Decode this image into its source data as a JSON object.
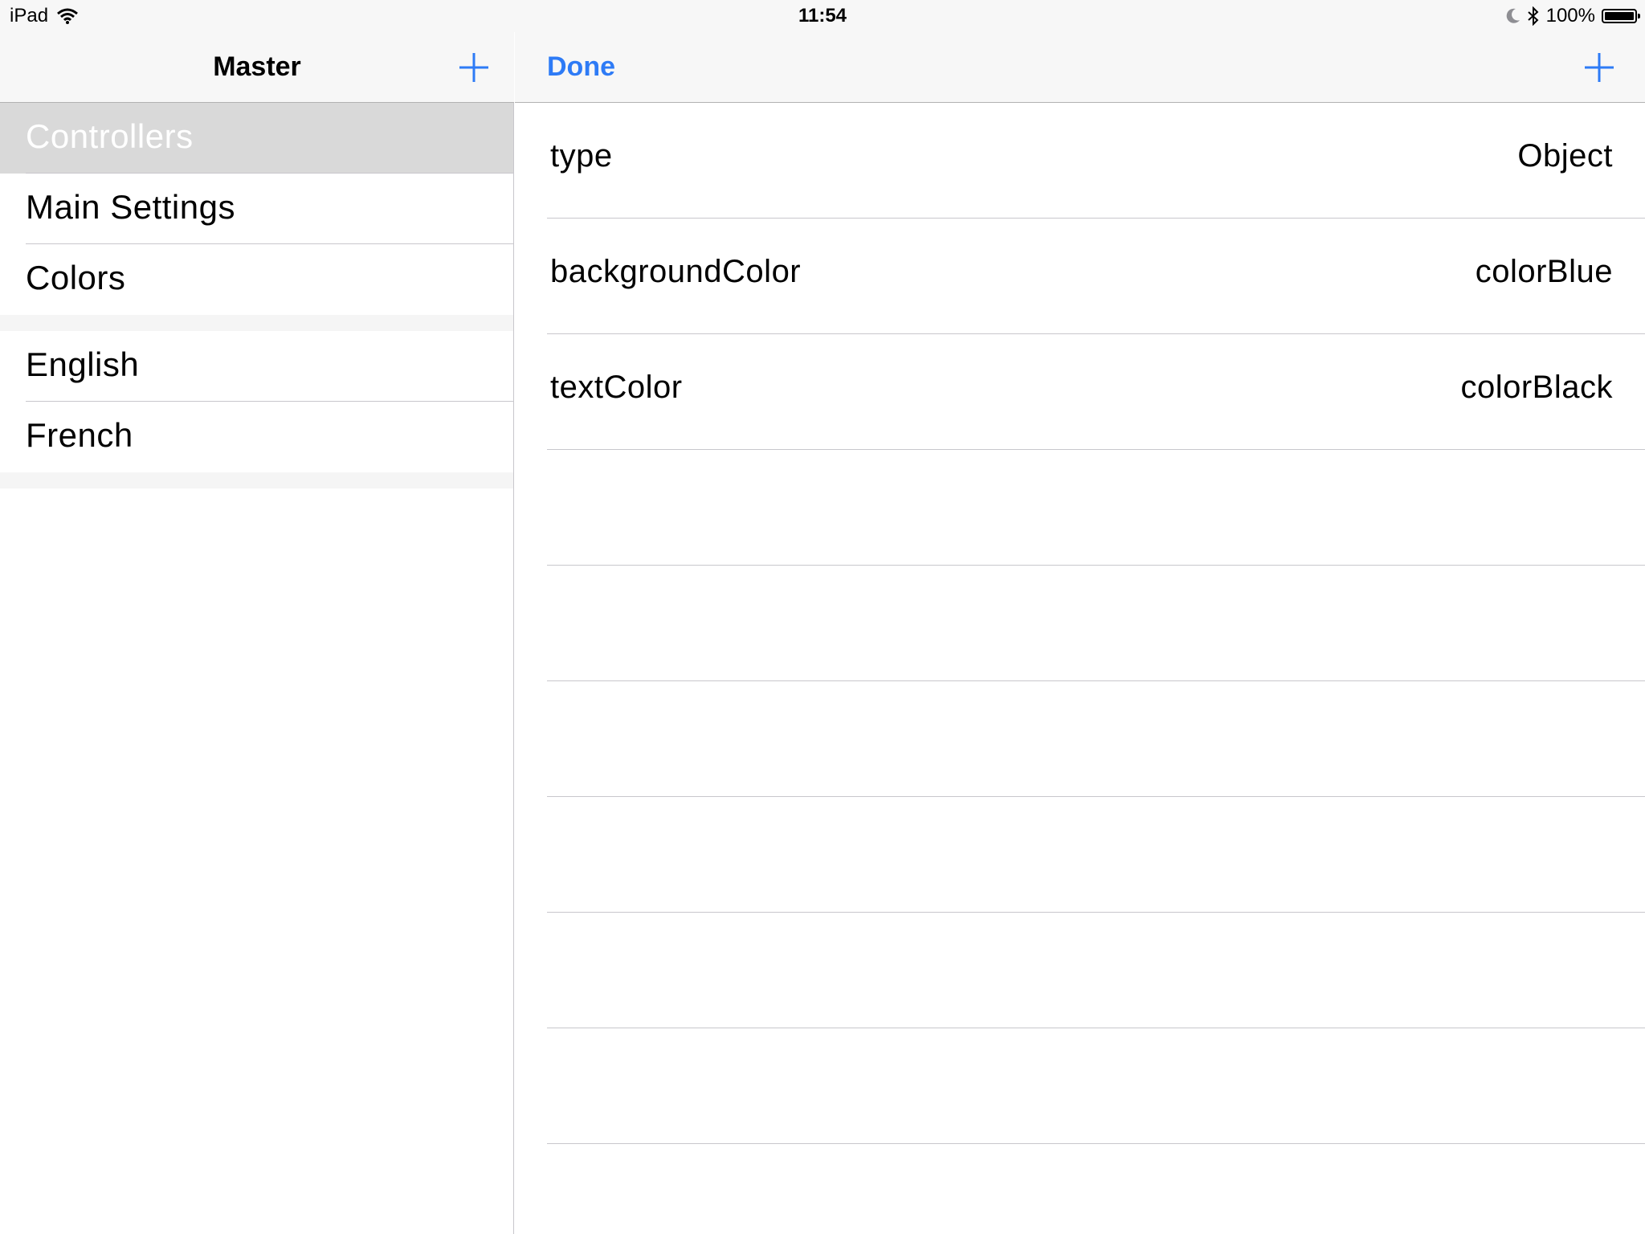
{
  "status_bar": {
    "device": "iPad",
    "time": "11:54",
    "battery_text": "100%",
    "battery_level": 1.0
  },
  "master": {
    "title": "Master",
    "add_icon": "plus-icon",
    "sections": [
      [
        {
          "label": "Controllers",
          "selected": true
        },
        {
          "label": "Main Settings",
          "selected": false
        },
        {
          "label": "Colors",
          "selected": false
        }
      ],
      [
        {
          "label": "English",
          "selected": false
        },
        {
          "label": "French",
          "selected": false
        }
      ]
    ]
  },
  "detail": {
    "done_label": "Done",
    "add_icon": "plus-icon",
    "rows": [
      {
        "key": "type",
        "value": "Object"
      },
      {
        "key": "backgroundColor",
        "value": "colorBlue"
      },
      {
        "key": "textColor",
        "value": "colorBlack"
      },
      {
        "key": "",
        "value": ""
      },
      {
        "key": "",
        "value": ""
      },
      {
        "key": "",
        "value": ""
      },
      {
        "key": "",
        "value": ""
      },
      {
        "key": "",
        "value": ""
      },
      {
        "key": "",
        "value": ""
      }
    ]
  },
  "colors": {
    "accent": "#2e7bf6",
    "selected_row": "#d9d9d9",
    "separator": "#c8c7cc"
  }
}
